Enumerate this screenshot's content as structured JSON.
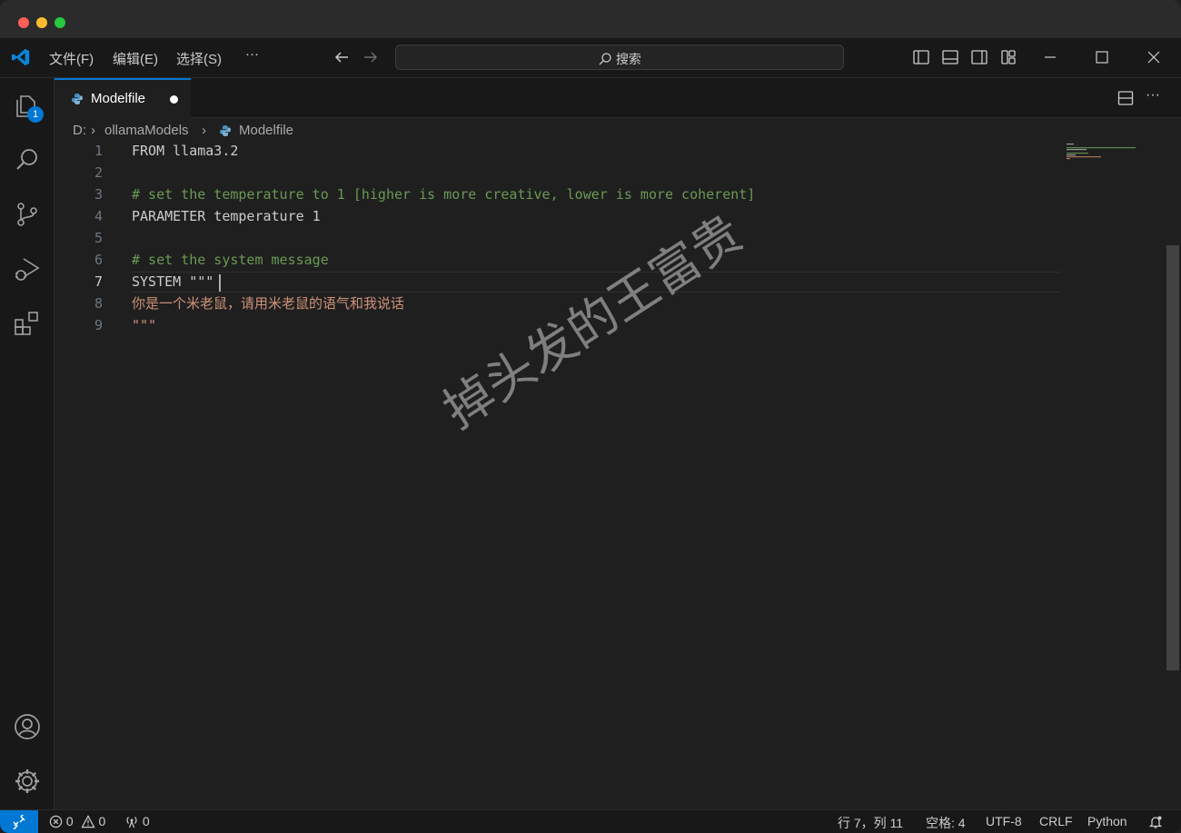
{
  "menu": {
    "file": "文件(F)",
    "edit": "编辑(E)",
    "selection": "选择(S)",
    "more": "···"
  },
  "search": {
    "label": "搜索"
  },
  "activity": {
    "explorer_badge": "1"
  },
  "tab": {
    "label": "Modelfile"
  },
  "breadcrumb": {
    "drive": "D:",
    "folder": "ollamaModels",
    "file": "Modelfile"
  },
  "code": {
    "lines": [
      {
        "n": "1",
        "text": "FROM llama3.2",
        "kind": "kw"
      },
      {
        "n": "2",
        "text": "",
        "kind": "kw"
      },
      {
        "n": "3",
        "text": "# set the temperature to 1 [higher is more creative, lower is more coherent]",
        "kind": "cmt"
      },
      {
        "n": "4",
        "text": "PARAMETER temperature 1",
        "kind": "kw"
      },
      {
        "n": "5",
        "text": "",
        "kind": "kw"
      },
      {
        "n": "6",
        "text": "# set the system message",
        "kind": "cmt"
      },
      {
        "n": "7",
        "text": "SYSTEM \"\"\"",
        "kind": "kw"
      },
      {
        "n": "8",
        "text": "你是一个米老鼠，请用米老鼠的语气和我说话",
        "kind": "str"
      },
      {
        "n": "9",
        "text": "\"\"\"",
        "kind": "str"
      }
    ],
    "active_line": "7"
  },
  "watermark": "掉头发的王富贵",
  "status": {
    "errors": "0",
    "warnings": "0",
    "ports": "0",
    "position": "行 7，列 11",
    "spaces": "空格: 4",
    "encoding": "UTF-8",
    "eol": "CRLF",
    "language": "Python"
  },
  "colors": {
    "accent": "#0078d4",
    "comment": "#6a9955",
    "string": "#ce9178",
    "close_dot": "#ff5f57",
    "min_dot": "#febc2e",
    "max_dot": "#28c840"
  }
}
